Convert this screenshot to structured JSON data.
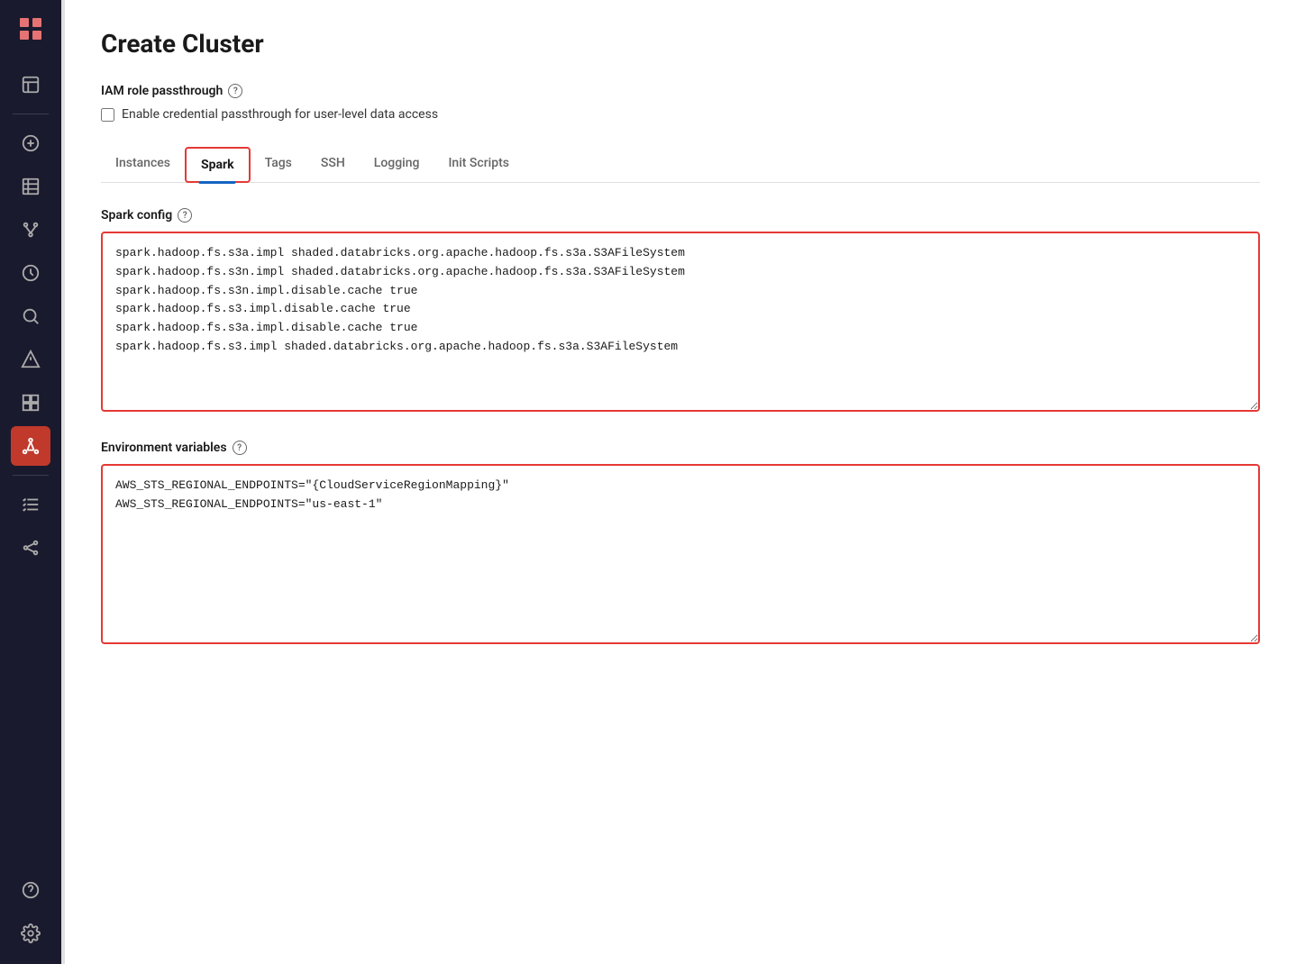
{
  "page": {
    "title": "Create Cluster"
  },
  "sidebar": {
    "icons": [
      {
        "name": "logo",
        "symbol": "≡",
        "active": false
      },
      {
        "name": "database-icon",
        "symbol": "D",
        "active": false
      },
      {
        "name": "add-icon",
        "symbol": "⊕",
        "active": false
      },
      {
        "name": "table-icon",
        "symbol": "⊞",
        "active": false
      },
      {
        "name": "repo-icon",
        "symbol": "⎇",
        "active": false
      },
      {
        "name": "clock-icon",
        "symbol": "◷",
        "active": false
      },
      {
        "name": "search-icon",
        "symbol": "⌕",
        "active": false
      },
      {
        "name": "alert-icon",
        "symbol": "△",
        "active": false
      },
      {
        "name": "cluster-icon",
        "symbol": "⛭",
        "active": true,
        "activeRed": true
      },
      {
        "name": "tasks-icon",
        "symbol": "≔",
        "active": false
      },
      {
        "name": "ml-icon",
        "symbol": "⚙",
        "active": false
      },
      {
        "name": "help-icon",
        "symbol": "?",
        "active": false
      },
      {
        "name": "settings-icon",
        "symbol": "⚙",
        "active": false
      }
    ]
  },
  "iam": {
    "label": "IAM role passthrough",
    "checkbox_label": "Enable credential passthrough for user-level data access",
    "checked": false
  },
  "tabs": [
    {
      "id": "instances",
      "label": "Instances",
      "active": false
    },
    {
      "id": "spark",
      "label": "Spark",
      "active": true
    },
    {
      "id": "tags",
      "label": "Tags",
      "active": false
    },
    {
      "id": "ssh",
      "label": "SSH",
      "active": false
    },
    {
      "id": "logging",
      "label": "Logging",
      "active": false
    },
    {
      "id": "init-scripts",
      "label": "Init Scripts",
      "active": false
    }
  ],
  "spark_config": {
    "label": "Spark config",
    "value": "spark.hadoop.fs.s3a.impl shaded.databricks.org.apache.hadoop.fs.s3a.S3AFileSystem\nspark.hadoop.fs.s3n.impl shaded.databricks.org.apache.hadoop.fs.s3a.S3AFileSystem\nspark.hadoop.fs.s3n.impl.disable.cache true\nspark.hadoop.fs.s3.impl.disable.cache true\nspark.hadoop.fs.s3a.impl.disable.cache true\nspark.hadoop.fs.s3.impl shaded.databricks.org.apache.hadoop.fs.s3a.S3AFileSystem"
  },
  "env_variables": {
    "label": "Environment variables",
    "value": "AWS_STS_REGIONAL_ENDPOINTS=\"{CloudServiceRegionMapping}\"\nAWS_STS_REGIONAL_ENDPOINTS=\"us-east-1\""
  }
}
